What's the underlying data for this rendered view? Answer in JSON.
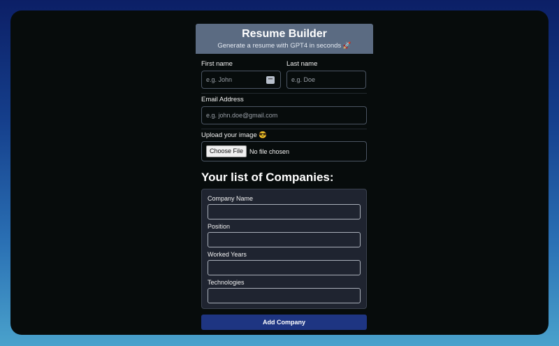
{
  "header": {
    "title": "Resume Builder",
    "subtitle": "Generate a resume with GPT4 in seconds 🚀"
  },
  "form": {
    "first_name_label": "First name",
    "first_name_placeholder": "e.g. John",
    "last_name_label": "Last name",
    "last_name_placeholder": "e.g. Doe",
    "email_label": "Email Address",
    "email_placeholder": "e.g. john.doe@gmail.com",
    "upload_label": "Upload your image 😎",
    "choose_file_label": "Choose File",
    "no_file_text": "No file chosen"
  },
  "companies": {
    "title": "Your list of Companies:",
    "fields": [
      {
        "label": "Company Name",
        "value": ""
      },
      {
        "label": "Position",
        "value": ""
      },
      {
        "label": "Worked Years",
        "value": ""
      },
      {
        "label": "Technologies",
        "value": ""
      }
    ],
    "add_button_label": "Add Company"
  },
  "colors": {
    "header_bg": "#5b6b82",
    "button_bg": "#1e3582",
    "window_bg": "#070c0c"
  }
}
